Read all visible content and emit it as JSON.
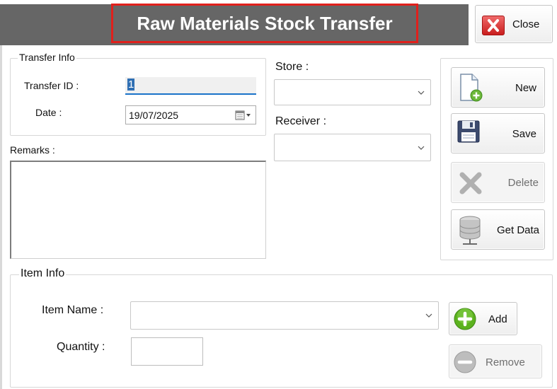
{
  "window": {
    "title": "Raw Materials Stock Transfer"
  },
  "toolbar": {
    "close_label": "Close"
  },
  "transfer_info": {
    "legend": "Transfer Info",
    "transfer_id_label": "Transfer ID :",
    "transfer_id_value": "1",
    "date_label": "Date :",
    "date_value": "19/07/2025"
  },
  "remarks": {
    "label": "Remarks :",
    "value": ""
  },
  "store": {
    "label": "Store :",
    "value": ""
  },
  "receiver": {
    "label": "Receiver :",
    "value": ""
  },
  "actions": {
    "new_label": "New",
    "save_label": "Save",
    "delete_label": "Delete",
    "get_data_label": "Get Data"
  },
  "item_info": {
    "legend": "Item Info",
    "item_name_label": "Item Name :",
    "item_name_value": "",
    "quantity_label": "Quantity :",
    "quantity_value": "",
    "add_label": "Add",
    "remove_label": "Remove"
  },
  "colors": {
    "title_bar": "#666666",
    "title_highlight": "#e0201c",
    "close_icon": "#d23434",
    "add_icon": "#5cb21f",
    "focus_underline": "#1a73c9"
  },
  "icons": {
    "close": "close-x-icon",
    "new": "new-document-icon",
    "save": "floppy-disk-icon",
    "delete": "delete-x-icon",
    "get_data": "database-icon",
    "add": "plus-circle-icon",
    "remove": "minus-circle-icon",
    "calendar": "calendar-icon"
  }
}
